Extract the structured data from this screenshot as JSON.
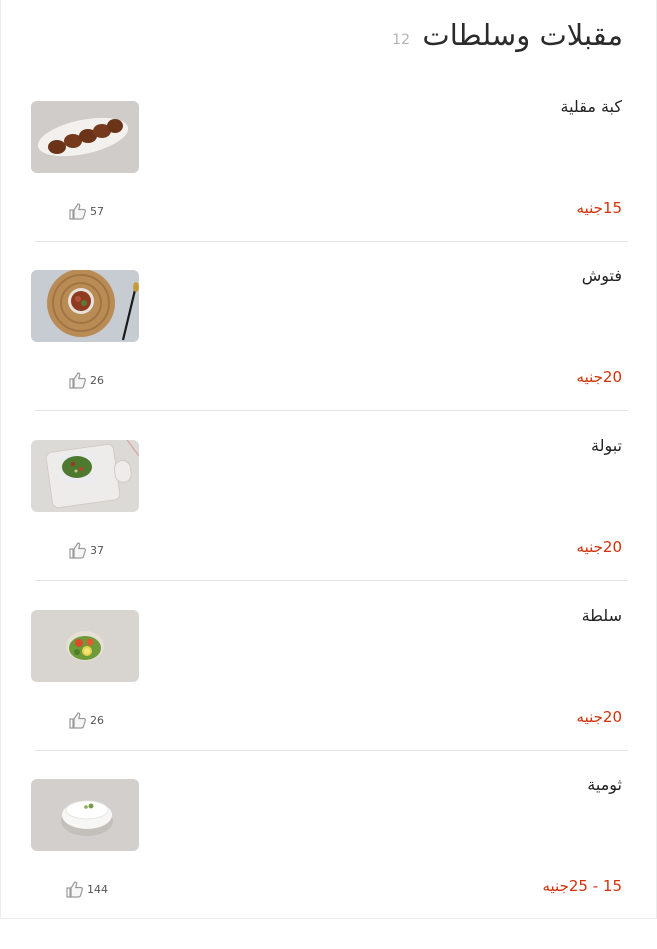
{
  "category": {
    "title": "مقبلات وسلطات",
    "count": "12"
  },
  "items": [
    {
      "name": "كبة مقلية",
      "price": "15جنيه",
      "likes": "57",
      "image": "fried-kibbeh-photo"
    },
    {
      "name": "فتوش",
      "price": "20جنيه",
      "likes": "26",
      "image": "fattoush-photo"
    },
    {
      "name": "تبولة",
      "price": "20جنيه",
      "likes": "37",
      "image": "tabbouleh-photo"
    },
    {
      "name": "سلطة",
      "price": "20جنيه",
      "likes": "26",
      "image": "salad-photo"
    },
    {
      "name": "ثومية",
      "price": "15 - 25جنيه",
      "likes": "144",
      "image": "toumieh-photo"
    }
  ],
  "colors": {
    "price": "#d2310a",
    "title": "#2b2b2b",
    "count": "#b4b4b4",
    "divider": "#e4e4e4"
  },
  "icons": {
    "like": "thumbs-up-icon"
  }
}
